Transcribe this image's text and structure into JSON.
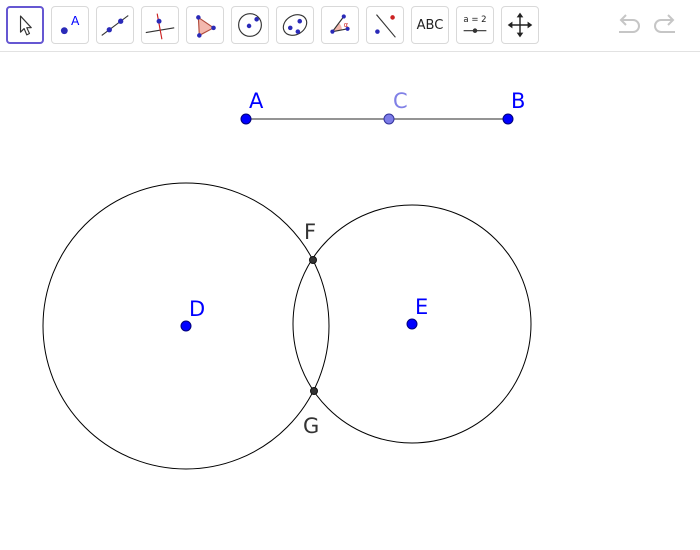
{
  "colors": {
    "point_free": "#0000ff",
    "point_dependent": "#7c7ce8",
    "point_intersection": "#333333",
    "label_free": "#0000ff",
    "label_dependent": "#8080e6",
    "label_intersection": "#333333",
    "tool_selected_border": "#6557d2",
    "line": "#555555",
    "circle": "#000000"
  },
  "toolbar": {
    "tools": [
      {
        "name": "move-tool-button",
        "icon": "cursor-arrow-icon",
        "selected": true
      },
      {
        "name": "point-tool-button",
        "icon": "point-icon",
        "icon_label": "A"
      },
      {
        "name": "line-tool-button",
        "icon": "line-through-points-icon"
      },
      {
        "name": "perpendicular-line-tool-button",
        "icon": "perpendicular-line-icon"
      },
      {
        "name": "polygon-tool-button",
        "icon": "polygon-icon"
      },
      {
        "name": "circle-center-point-tool-button",
        "icon": "circle-center-point-icon"
      },
      {
        "name": "conic-tool-button",
        "icon": "ellipse-icon"
      },
      {
        "name": "angle-tool-button",
        "icon": "angle-icon",
        "icon_label": "α"
      },
      {
        "name": "reflect-tool-button",
        "icon": "reflect-about-line-icon"
      },
      {
        "name": "text-tool-button",
        "icon": "text-icon",
        "label": "ABC"
      },
      {
        "name": "slider-tool-button",
        "icon": "slider-icon",
        "label": "a = 2"
      },
      {
        "name": "move-graphics-view-tool-button",
        "icon": "move-view-arrows-icon"
      }
    ],
    "undo_icon": "undo-icon",
    "redo_icon": "redo-icon"
  },
  "construction": {
    "points": {
      "A": {
        "label": "A"
      },
      "B": {
        "label": "B"
      },
      "C": {
        "label": "C"
      },
      "D": {
        "label": "D"
      },
      "E": {
        "label": "E"
      },
      "F": {
        "label": "F"
      },
      "G": {
        "label": "G"
      }
    },
    "segment": {
      "from": "A",
      "to": "B"
    },
    "midpoint": "C",
    "circles": [
      {
        "center": "D"
      },
      {
        "center": "E"
      }
    ],
    "intersections": [
      "F",
      "G"
    ]
  }
}
